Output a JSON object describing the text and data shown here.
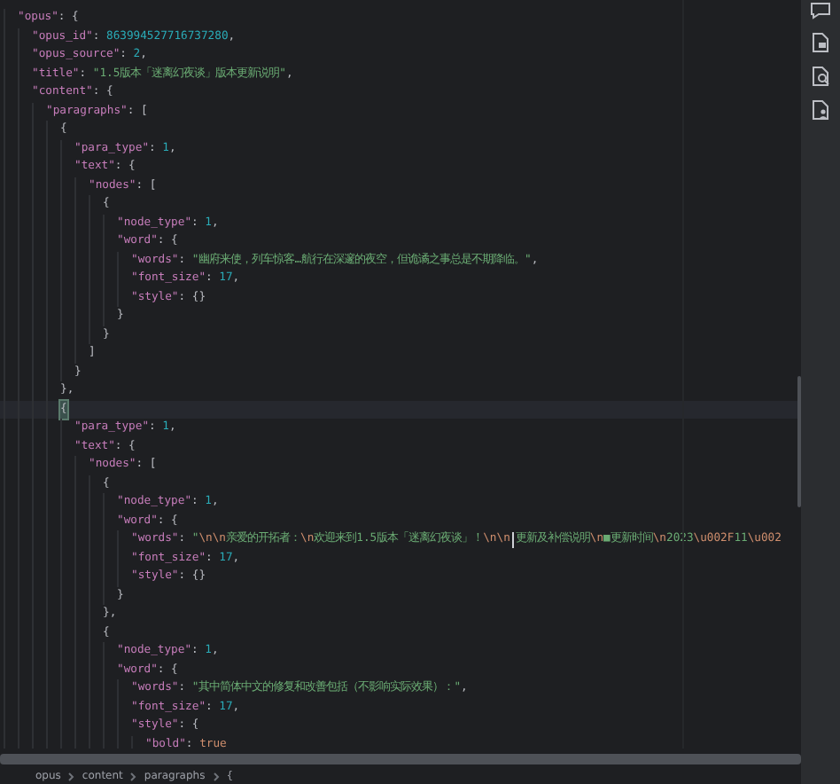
{
  "editor": {
    "lines": [
      {
        "tokens": [
          {
            "kind": "key",
            "text": "\"opus\""
          },
          {
            "kind": "punct",
            "text": ": {"
          }
        ],
        "children": [
          {
            "tokens": [
              {
                "kind": "key",
                "text": "\"opus_id\""
              },
              {
                "kind": "punct",
                "text": ": "
              },
              {
                "kind": "num",
                "text": "863994527716737280"
              },
              {
                "kind": "punct",
                "text": ","
              }
            ]
          },
          {
            "tokens": [
              {
                "kind": "key",
                "text": "\"opus_source\""
              },
              {
                "kind": "punct",
                "text": ": "
              },
              {
                "kind": "num",
                "text": "2"
              },
              {
                "kind": "punct",
                "text": ","
              }
            ]
          },
          {
            "tokens": [
              {
                "kind": "key",
                "text": "\"title\""
              },
              {
                "kind": "punct",
                "text": ": "
              },
              {
                "kind": "str",
                "text": "\"1.5版本「迷离幻夜谈」版本更新说明\""
              },
              {
                "kind": "punct",
                "text": ","
              }
            ]
          },
          {
            "tokens": [
              {
                "kind": "key",
                "text": "\"content\""
              },
              {
                "kind": "punct",
                "text": ": {"
              }
            ],
            "children": [
              {
                "tokens": [
                  {
                    "kind": "key",
                    "text": "\"paragraphs\""
                  },
                  {
                    "kind": "punct",
                    "text": ": ["
                  }
                ],
                "children": [
                  {
                    "tokens": [
                      {
                        "kind": "punct",
                        "text": "{"
                      }
                    ],
                    "children": [
                      {
                        "tokens": [
                          {
                            "kind": "key",
                            "text": "\"para_type\""
                          },
                          {
                            "kind": "punct",
                            "text": ": "
                          },
                          {
                            "kind": "num",
                            "text": "1"
                          },
                          {
                            "kind": "punct",
                            "text": ","
                          }
                        ]
                      },
                      {
                        "tokens": [
                          {
                            "kind": "key",
                            "text": "\"text\""
                          },
                          {
                            "kind": "punct",
                            "text": ": {"
                          }
                        ],
                        "children": [
                          {
                            "tokens": [
                              {
                                "kind": "key",
                                "text": "\"nodes\""
                              },
                              {
                                "kind": "punct",
                                "text": ": ["
                              }
                            ],
                            "children": [
                              {
                                "tokens": [
                                  {
                                    "kind": "punct",
                                    "text": "{"
                                  }
                                ],
                                "children": [
                                  {
                                    "tokens": [
                                      {
                                        "kind": "key",
                                        "text": "\"node_type\""
                                      },
                                      {
                                        "kind": "punct",
                                        "text": ": "
                                      },
                                      {
                                        "kind": "num",
                                        "text": "1"
                                      },
                                      {
                                        "kind": "punct",
                                        "text": ","
                                      }
                                    ]
                                  },
                                  {
                                    "tokens": [
                                      {
                                        "kind": "key",
                                        "text": "\"word\""
                                      },
                                      {
                                        "kind": "punct",
                                        "text": ": {"
                                      }
                                    ],
                                    "children": [
                                      {
                                        "tokens": [
                                          {
                                            "kind": "key",
                                            "text": "\"words\""
                                          },
                                          {
                                            "kind": "punct",
                                            "text": ": "
                                          },
                                          {
                                            "kind": "str",
                                            "text": "\"幽府来使，列车惊客…航行在深邃的夜空，但诡谲之事总是不期降临。\""
                                          },
                                          {
                                            "kind": "punct",
                                            "text": ","
                                          }
                                        ]
                                      },
                                      {
                                        "tokens": [
                                          {
                                            "kind": "key",
                                            "text": "\"font_size\""
                                          },
                                          {
                                            "kind": "punct",
                                            "text": ": "
                                          },
                                          {
                                            "kind": "num",
                                            "text": "17"
                                          },
                                          {
                                            "kind": "punct",
                                            "text": ","
                                          }
                                        ]
                                      },
                                      {
                                        "tokens": [
                                          {
                                            "kind": "key",
                                            "text": "\"style\""
                                          },
                                          {
                                            "kind": "punct",
                                            "text": ": {}"
                                          }
                                        ]
                                      }
                                    ]
                                  },
                                  {
                                    "tokens": [
                                      {
                                        "kind": "punct",
                                        "text": "}"
                                      }
                                    ]
                                  }
                                ]
                              },
                              {
                                "tokens": [
                                  {
                                    "kind": "punct",
                                    "text": "}"
                                  }
                                ]
                              }
                            ]
                          },
                          {
                            "tokens": [
                              {
                                "kind": "punct",
                                "text": "]"
                              }
                            ]
                          }
                        ]
                      },
                      {
                        "tokens": [
                          {
                            "kind": "punct",
                            "text": "}"
                          }
                        ]
                      }
                    ]
                  },
                  {
                    "tokens": [
                      {
                        "kind": "punct",
                        "text": "},"
                      }
                    ]
                  },
                  {
                    "current": true,
                    "tokens": [
                      {
                        "kind": "brace",
                        "text": "{"
                      }
                    ],
                    "children": [
                      {
                        "tokens": [
                          {
                            "kind": "key",
                            "text": "\"para_type\""
                          },
                          {
                            "kind": "punct",
                            "text": ": "
                          },
                          {
                            "kind": "num",
                            "text": "1"
                          },
                          {
                            "kind": "punct",
                            "text": ","
                          }
                        ]
                      },
                      {
                        "tokens": [
                          {
                            "kind": "key",
                            "text": "\"text\""
                          },
                          {
                            "kind": "punct",
                            "text": ": {"
                          }
                        ],
                        "children": [
                          {
                            "tokens": [
                              {
                                "kind": "key",
                                "text": "\"nodes\""
                              },
                              {
                                "kind": "punct",
                                "text": ": ["
                              }
                            ],
                            "children": [
                              {
                                "tokens": [
                                  {
                                    "kind": "punct",
                                    "text": "{"
                                  }
                                ],
                                "children": [
                                  {
                                    "tokens": [
                                      {
                                        "kind": "key",
                                        "text": "\"node_type\""
                                      },
                                      {
                                        "kind": "punct",
                                        "text": ": "
                                      },
                                      {
                                        "kind": "num",
                                        "text": "1"
                                      },
                                      {
                                        "kind": "punct",
                                        "text": ","
                                      }
                                    ]
                                  },
                                  {
                                    "tokens": [
                                      {
                                        "kind": "key",
                                        "text": "\"word\""
                                      },
                                      {
                                        "kind": "punct",
                                        "text": ": {"
                                      }
                                    ],
                                    "children": [
                                      {
                                        "tokens": [
                                          {
                                            "kind": "key",
                                            "text": "\"words\""
                                          },
                                          {
                                            "kind": "punct",
                                            "text": ": "
                                          },
                                          {
                                            "kind": "str",
                                            "text": "\""
                                          },
                                          {
                                            "kind": "esc",
                                            "text": "\\n\\n"
                                          },
                                          {
                                            "kind": "str",
                                            "text": "亲爱的开拓者："
                                          },
                                          {
                                            "kind": "esc",
                                            "text": "\\n"
                                          },
                                          {
                                            "kind": "str",
                                            "text": "欢迎来到1.5版本「迷离幻夜谈」！"
                                          },
                                          {
                                            "kind": "esc",
                                            "text": "\\n\\n",
                                            "caret": true
                                          },
                                          {
                                            "kind": "str",
                                            "text": "更新及补偿说明"
                                          },
                                          {
                                            "kind": "esc",
                                            "text": "\\n"
                                          },
                                          {
                                            "kind": "str",
                                            "text": "■更新时间"
                                          },
                                          {
                                            "kind": "esc",
                                            "text": "\\n"
                                          },
                                          {
                                            "kind": "str",
                                            "text": "2023"
                                          },
                                          {
                                            "kind": "esc",
                                            "text": "\\u002F"
                                          },
                                          {
                                            "kind": "str",
                                            "text": "11"
                                          },
                                          {
                                            "kind": "esc",
                                            "text": "\\u002"
                                          }
                                        ]
                                      },
                                      {
                                        "tokens": [
                                          {
                                            "kind": "key",
                                            "text": "\"font_size\""
                                          },
                                          {
                                            "kind": "punct",
                                            "text": ": "
                                          },
                                          {
                                            "kind": "num",
                                            "text": "17"
                                          },
                                          {
                                            "kind": "punct",
                                            "text": ","
                                          }
                                        ]
                                      },
                                      {
                                        "tokens": [
                                          {
                                            "kind": "key",
                                            "text": "\"style\""
                                          },
                                          {
                                            "kind": "punct",
                                            "text": ": {}"
                                          }
                                        ]
                                      }
                                    ]
                                  },
                                  {
                                    "tokens": [
                                      {
                                        "kind": "punct",
                                        "text": "}"
                                      }
                                    ]
                                  }
                                ]
                              },
                              {
                                "tokens": [
                                  {
                                    "kind": "punct",
                                    "text": "},"
                                  }
                                ]
                              },
                              {
                                "tokens": [
                                  {
                                    "kind": "punct",
                                    "text": "{"
                                  }
                                ],
                                "children": [
                                  {
                                    "tokens": [
                                      {
                                        "kind": "key",
                                        "text": "\"node_type\""
                                      },
                                      {
                                        "kind": "punct",
                                        "text": ": "
                                      },
                                      {
                                        "kind": "num",
                                        "text": "1"
                                      },
                                      {
                                        "kind": "punct",
                                        "text": ","
                                      }
                                    ]
                                  },
                                  {
                                    "tokens": [
                                      {
                                        "kind": "key",
                                        "text": "\"word\""
                                      },
                                      {
                                        "kind": "punct",
                                        "text": ": {"
                                      }
                                    ],
                                    "children": [
                                      {
                                        "tokens": [
                                          {
                                            "kind": "key",
                                            "text": "\"words\""
                                          },
                                          {
                                            "kind": "punct",
                                            "text": ": "
                                          },
                                          {
                                            "kind": "str",
                                            "text": "\"其中简体中文的修复和改善包括（不影响实际效果）：\""
                                          },
                                          {
                                            "kind": "punct",
                                            "text": ","
                                          }
                                        ]
                                      },
                                      {
                                        "tokens": [
                                          {
                                            "kind": "key",
                                            "text": "\"font_size\""
                                          },
                                          {
                                            "kind": "punct",
                                            "text": ": "
                                          },
                                          {
                                            "kind": "num",
                                            "text": "17"
                                          },
                                          {
                                            "kind": "punct",
                                            "text": ","
                                          }
                                        ]
                                      },
                                      {
                                        "tokens": [
                                          {
                                            "kind": "key",
                                            "text": "\"style\""
                                          },
                                          {
                                            "kind": "punct",
                                            "text": ": {"
                                          }
                                        ],
                                        "children": [
                                          {
                                            "tokens": [
                                              {
                                                "kind": "key",
                                                "text": "\"bold\""
                                              },
                                              {
                                                "kind": "punct",
                                                "text": ": "
                                              },
                                              {
                                                "kind": "bool",
                                                "text": "true"
                                              }
                                            ]
                                          }
                                        ]
                                      }
                                    ]
                                  }
                                ]
                              }
                            ]
                          }
                        ]
                      }
                    ]
                  }
                ]
              }
            ]
          }
        ]
      }
    ]
  },
  "breadcrumbs": [
    "opus",
    "content",
    "paragraphs",
    "{"
  ]
}
